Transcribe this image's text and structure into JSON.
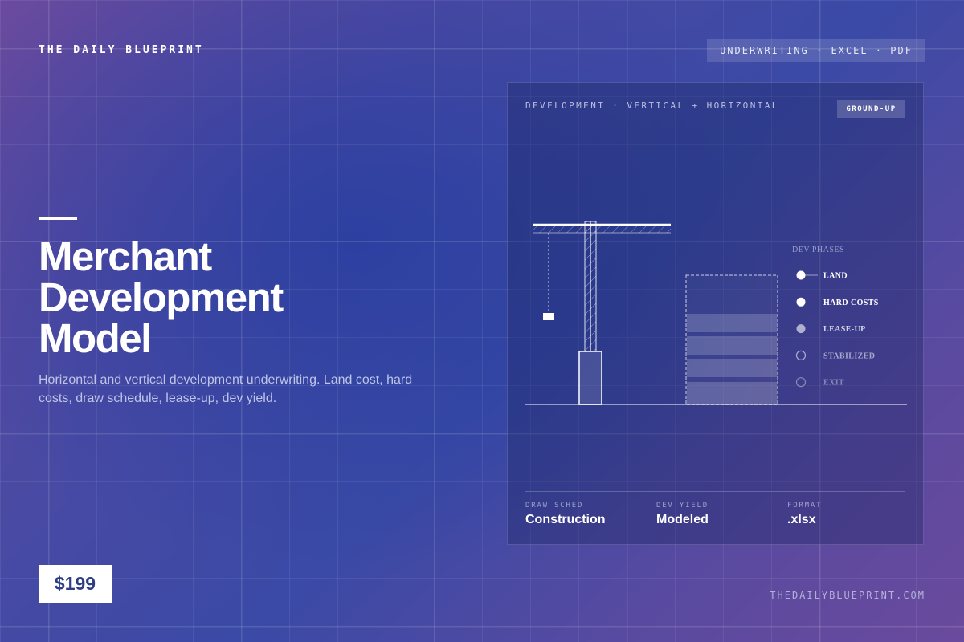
{
  "brand": "THE DAILY BLUEPRINT",
  "top_tag": "UNDERWRITING · EXCEL · PDF",
  "headline": [
    "Merchant",
    "Development",
    "Model"
  ],
  "subtitle": "Horizontal and vertical development underwriting. Land cost, hard costs, draw schedule, lease-up, dev yield.",
  "price": "$199",
  "domain": "THEDAILYBLUEPRINT.COM",
  "card": {
    "label": "DEVELOPMENT · VERTICAL + HORIZONTAL",
    "badge": "GROUND-UP",
    "phases_title": "DEV PHASES",
    "phases": [
      {
        "label": "LAND",
        "state": "complete"
      },
      {
        "label": "HARD COSTS",
        "state": "complete"
      },
      {
        "label": "LEASE-UP",
        "state": "active"
      },
      {
        "label": "STABILIZED",
        "state": "pending"
      },
      {
        "label": "EXIT",
        "state": "pending"
      }
    ],
    "stats": [
      {
        "label": "DRAW SCHED",
        "value": "Construction"
      },
      {
        "label": "DEV YIELD",
        "value": "Modeled"
      },
      {
        "label": "FORMAT",
        "value": ".xlsx"
      }
    ]
  },
  "icons": {
    "crane": "tower-crane-icon",
    "building": "building-under-construction-icon"
  }
}
